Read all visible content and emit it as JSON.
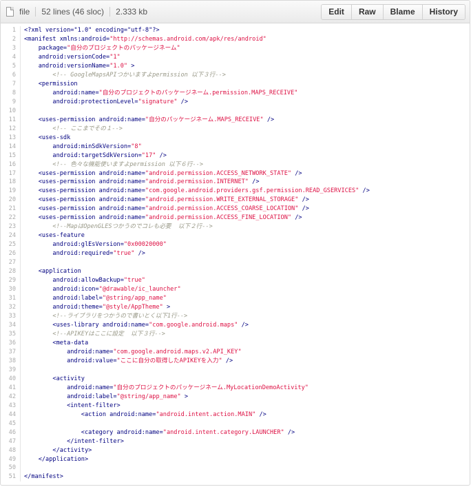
{
  "header": {
    "file_label": "file",
    "lines_label": "52 lines (46 sloc)",
    "size_label": "2.333 kb",
    "buttons": [
      "Edit",
      "Raw",
      "Blame",
      "History"
    ]
  },
  "colors": {
    "tag": "#000080",
    "string": "#dd1144",
    "comment": "#999988"
  },
  "code_lines": [
    [
      [
        "k",
        "<?xml version=\"1.0\" encoding=\"utf-8\"?>"
      ]
    ],
    [
      [
        "k",
        "<manifest xmlns:android="
      ],
      [
        "s",
        "\"http://schemas.android.com/apk/res/android\""
      ]
    ],
    [
      [
        "k",
        "    package="
      ],
      [
        "s",
        "\"自分のプロジェクトのパッケージネーム\""
      ]
    ],
    [
      [
        "k",
        "    android:versionCode="
      ],
      [
        "s",
        "\"1\""
      ]
    ],
    [
      [
        "k",
        "    android:versionName="
      ],
      [
        "s",
        "\"1.0\""
      ],
      [
        "k",
        " >"
      ]
    ],
    [
      [
        "c",
        "        <!-- GoogleMapsAPIつかいますよpermission 以下３行-->"
      ]
    ],
    [
      [
        "k",
        "    <permission"
      ]
    ],
    [
      [
        "k",
        "        android:name="
      ],
      [
        "s",
        "\"自分のプロジェクトのパッケージネーム.permission.MAPS_RECEIVE\""
      ]
    ],
    [
      [
        "k",
        "        android:protectionLevel="
      ],
      [
        "s",
        "\"signature\""
      ],
      [
        "k",
        " />"
      ]
    ],
    [
      [
        "k",
        ""
      ]
    ],
    [
      [
        "k",
        "    <uses-permission android:name="
      ],
      [
        "s",
        "\"自分のパッケージネーム.MAPS_RECEIVE\""
      ],
      [
        "k",
        " />"
      ]
    ],
    [
      [
        "c",
        "        <!-- ここまでその１-->"
      ]
    ],
    [
      [
        "k",
        "    <uses-sdk"
      ]
    ],
    [
      [
        "k",
        "        android:minSdkVersion="
      ],
      [
        "s",
        "\"8\""
      ]
    ],
    [
      [
        "k",
        "        android:targetSdkVersion="
      ],
      [
        "s",
        "\"17\""
      ],
      [
        "k",
        " />"
      ]
    ],
    [
      [
        "c",
        "        <!-- 色々な機能使いますよpermission 以下６行-->"
      ]
    ],
    [
      [
        "k",
        "    <uses-permission android:name="
      ],
      [
        "s",
        "\"android.permission.ACCESS_NETWORK_STATE\""
      ],
      [
        "k",
        " />"
      ]
    ],
    [
      [
        "k",
        "    <uses-permission android:name="
      ],
      [
        "s",
        "\"android.permission.INTERNET\""
      ],
      [
        "k",
        " />"
      ]
    ],
    [
      [
        "k",
        "    <uses-permission android:name="
      ],
      [
        "s",
        "\"com.google.android.providers.gsf.permission.READ_GSERVICES\""
      ],
      [
        "k",
        " />"
      ]
    ],
    [
      [
        "k",
        "    <uses-permission android:name="
      ],
      [
        "s",
        "\"android.permission.WRITE_EXTERNAL_STORAGE\""
      ],
      [
        "k",
        " />"
      ]
    ],
    [
      [
        "k",
        "    <uses-permission android:name="
      ],
      [
        "s",
        "\"android.permission.ACCESS_COARSE_LOCATION\""
      ],
      [
        "k",
        " />"
      ]
    ],
    [
      [
        "k",
        "    <uses-permission android:name="
      ],
      [
        "s",
        "\"android.permission.ACCESS_FINE_LOCATION\""
      ],
      [
        "k",
        " />"
      ]
    ],
    [
      [
        "c",
        "        <!--MapはOpenGLESつかうのでコレも必要  以下２行-->"
      ]
    ],
    [
      [
        "k",
        "    <uses-feature"
      ]
    ],
    [
      [
        "k",
        "        android:glEsVersion="
      ],
      [
        "s",
        "\"0x00020000\""
      ]
    ],
    [
      [
        "k",
        "        android:required="
      ],
      [
        "s",
        "\"true\""
      ],
      [
        "k",
        " />"
      ]
    ],
    [
      [
        "k",
        ""
      ]
    ],
    [
      [
        "k",
        "    <application"
      ]
    ],
    [
      [
        "k",
        "        android:allowBackup="
      ],
      [
        "s",
        "\"true\""
      ]
    ],
    [
      [
        "k",
        "        android:icon="
      ],
      [
        "s",
        "\"@drawable/ic_launcher\""
      ]
    ],
    [
      [
        "k",
        "        android:label="
      ],
      [
        "s",
        "\"@string/app_name\""
      ]
    ],
    [
      [
        "k",
        "        android:theme="
      ],
      [
        "s",
        "\"@style/AppTheme\""
      ],
      [
        "k",
        " >"
      ]
    ],
    [
      [
        "c",
        "        <!--ライブラリをつかうので書いとく以下1行-->"
      ]
    ],
    [
      [
        "k",
        "        <uses-library android:name="
      ],
      [
        "s",
        "\"com.google.android.maps\""
      ],
      [
        "k",
        " />"
      ]
    ],
    [
      [
        "c",
        "        <!--APIKEYはここに設定  以下３行-->"
      ]
    ],
    [
      [
        "k",
        "        <meta-data"
      ]
    ],
    [
      [
        "k",
        "            android:name="
      ],
      [
        "s",
        "\"com.google.android.maps.v2.API_KEY\""
      ]
    ],
    [
      [
        "k",
        "            android:value="
      ],
      [
        "s",
        "\"ここに自分の取得したAPIKEYを入力\""
      ],
      [
        "k",
        " />"
      ]
    ],
    [
      [
        "k",
        ""
      ]
    ],
    [
      [
        "k",
        "        <activity"
      ]
    ],
    [
      [
        "k",
        "            android:name="
      ],
      [
        "s",
        "\"自分のプロジェクトのパッケージネーム.MyLocationDemoActivity\""
      ]
    ],
    [
      [
        "k",
        "            android:label="
      ],
      [
        "s",
        "\"@string/app_name\""
      ],
      [
        "k",
        " >"
      ]
    ],
    [
      [
        "k",
        "            <intent-filter>"
      ]
    ],
    [
      [
        "k",
        "                <action android:name="
      ],
      [
        "s",
        "\"android.intent.action.MAIN\""
      ],
      [
        "k",
        " />"
      ]
    ],
    [
      [
        "k",
        ""
      ]
    ],
    [
      [
        "k",
        "                <category android:name="
      ],
      [
        "s",
        "\"android.intent.category.LAUNCHER\""
      ],
      [
        "k",
        " />"
      ]
    ],
    [
      [
        "k",
        "            </intent-filter>"
      ]
    ],
    [
      [
        "k",
        "        </activity>"
      ]
    ],
    [
      [
        "k",
        "    </application>"
      ]
    ],
    [
      [
        "k",
        ""
      ]
    ],
    [
      [
        "k",
        "</manifest>"
      ]
    ]
  ]
}
